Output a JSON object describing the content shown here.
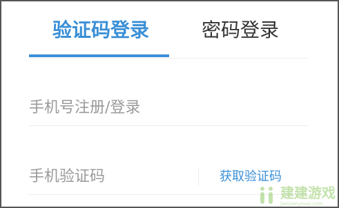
{
  "tabs": {
    "sms_login_label": "验证码登录",
    "password_login_label": "密码登录",
    "active": "sms"
  },
  "form": {
    "phone_placeholder": "手机号注册/登录",
    "code_placeholder": "手机验证码",
    "get_code_label": "获取验证码"
  },
  "watermark": {
    "text": "建建游戏",
    "subtext": "jianjianyouxi.com",
    "icon": "game-site-logo-icon"
  },
  "colors": {
    "accent": "#3a8fd6",
    "inactive_text": "#333333",
    "placeholder": "#9a9a9a",
    "divider": "#eeeeee",
    "border": "#555555",
    "watermark": "#7cbf4a"
  }
}
